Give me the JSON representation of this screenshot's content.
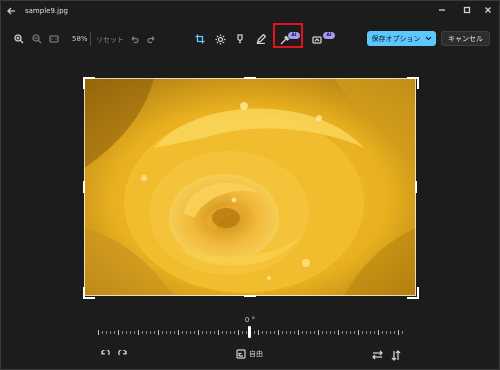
{
  "window": {
    "title": "sample9.jpg",
    "controls": [
      "minimize-icon",
      "maximize-icon",
      "close-icon"
    ]
  },
  "toolbar": {
    "zoom_level": "58%",
    "reset_label": "リセット",
    "ai_badge": "AI",
    "tools": [
      "crop-icon",
      "brightness-icon",
      "markup-icon",
      "draw-icon",
      "retouch-icon",
      "background-blur-icon"
    ],
    "save_label": "保存オプション",
    "cancel_label": "キャンセル"
  },
  "highlight_color": "#e0141e",
  "accent_color": "#5cc8ff",
  "rotation": {
    "angle_label": "0 °"
  },
  "bottom_bar": {
    "aspect_label": "自由"
  }
}
